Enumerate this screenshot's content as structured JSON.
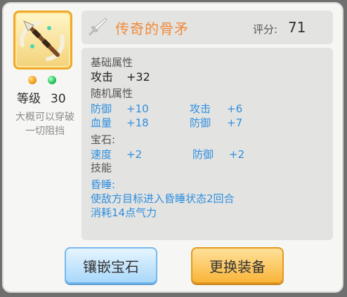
{
  "item": {
    "name": "传奇的骨矛",
    "score_label": "评分:",
    "score_value": "71",
    "level_label": "等级",
    "level_value": "30",
    "description": "大概可以穿破一切阻挡",
    "icon": "bone-spear-icon",
    "gems": [
      "orange-gem-icon",
      "green-gem-icon"
    ]
  },
  "attributes": {
    "base_title": "基础属性",
    "base": [
      {
        "name": "攻击",
        "value": "+32"
      }
    ],
    "random_title": "随机属性",
    "random": [
      {
        "name": "防御",
        "value": "+10"
      },
      {
        "name": "攻击",
        "value": "+6"
      },
      {
        "name": "血量",
        "value": "+18"
      },
      {
        "name": "防御",
        "value": "+7"
      }
    ],
    "gem_title": "宝石:",
    "gem_stats": [
      {
        "name": "速度",
        "value": "+2"
      },
      {
        "name": "防御",
        "value": "+2"
      }
    ],
    "skill_title": "技能",
    "skill_name": "昏睡:",
    "skill_lines": [
      "使敌方目标进入昏睡状态2回合",
      "消耗14点气力"
    ]
  },
  "buttons": {
    "inlay": "镶嵌宝石",
    "replace": "更换装备"
  },
  "colors": {
    "name": "#f08a3a",
    "stat_blue": "#2f8fde",
    "frame_gold": "#f0a928"
  }
}
